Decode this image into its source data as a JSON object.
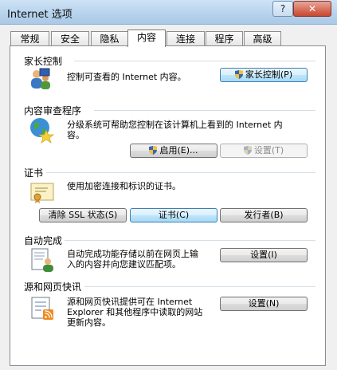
{
  "window": {
    "title": "Internet 选项",
    "help_label": "?",
    "close_label": "✕"
  },
  "tabs": [
    {
      "label": "常规"
    },
    {
      "label": "安全"
    },
    {
      "label": "隐私"
    },
    {
      "label": "内容"
    },
    {
      "label": "连接"
    },
    {
      "label": "程序"
    },
    {
      "label": "高级"
    }
  ],
  "active_tab": "内容",
  "sections": {
    "parental": {
      "title": "家长控制",
      "desc": "控制可查看的 Internet 内容。",
      "button": "家长控制(P)"
    },
    "advisor": {
      "title": "内容审查程序",
      "desc_line1": "分级系统可帮助您控制在该计算机上看到的 Internet 内",
      "desc_line2": "容。",
      "enable_button": "启用(E)...",
      "settings_button": "设置(T)"
    },
    "certs": {
      "title": "证书",
      "desc": "使用加密连接和标识的证书。",
      "clear_ssl_button": "清除 SSL 状态(S)",
      "certs_button": "证书(C)",
      "publishers_button": "发行者(B)"
    },
    "autocomplete": {
      "title": "自动完成",
      "desc_line1": "自动完成功能存储以前在网页上输",
      "desc_line2": "入的内容并向您建议匹配项。",
      "settings_button": "设置(I)"
    },
    "feeds": {
      "title": "源和网页快讯",
      "desc_line1": "源和网页快讯提供可在 Internet",
      "desc_line2": "Explorer 和其他程序中读取的网站",
      "desc_line3": "更新内容。",
      "settings_button": "设置(N)"
    }
  },
  "colors": {
    "accent": "#3c7fb1",
    "titlebar": "#b9d5ee",
    "separator": "#d5dfe5"
  }
}
